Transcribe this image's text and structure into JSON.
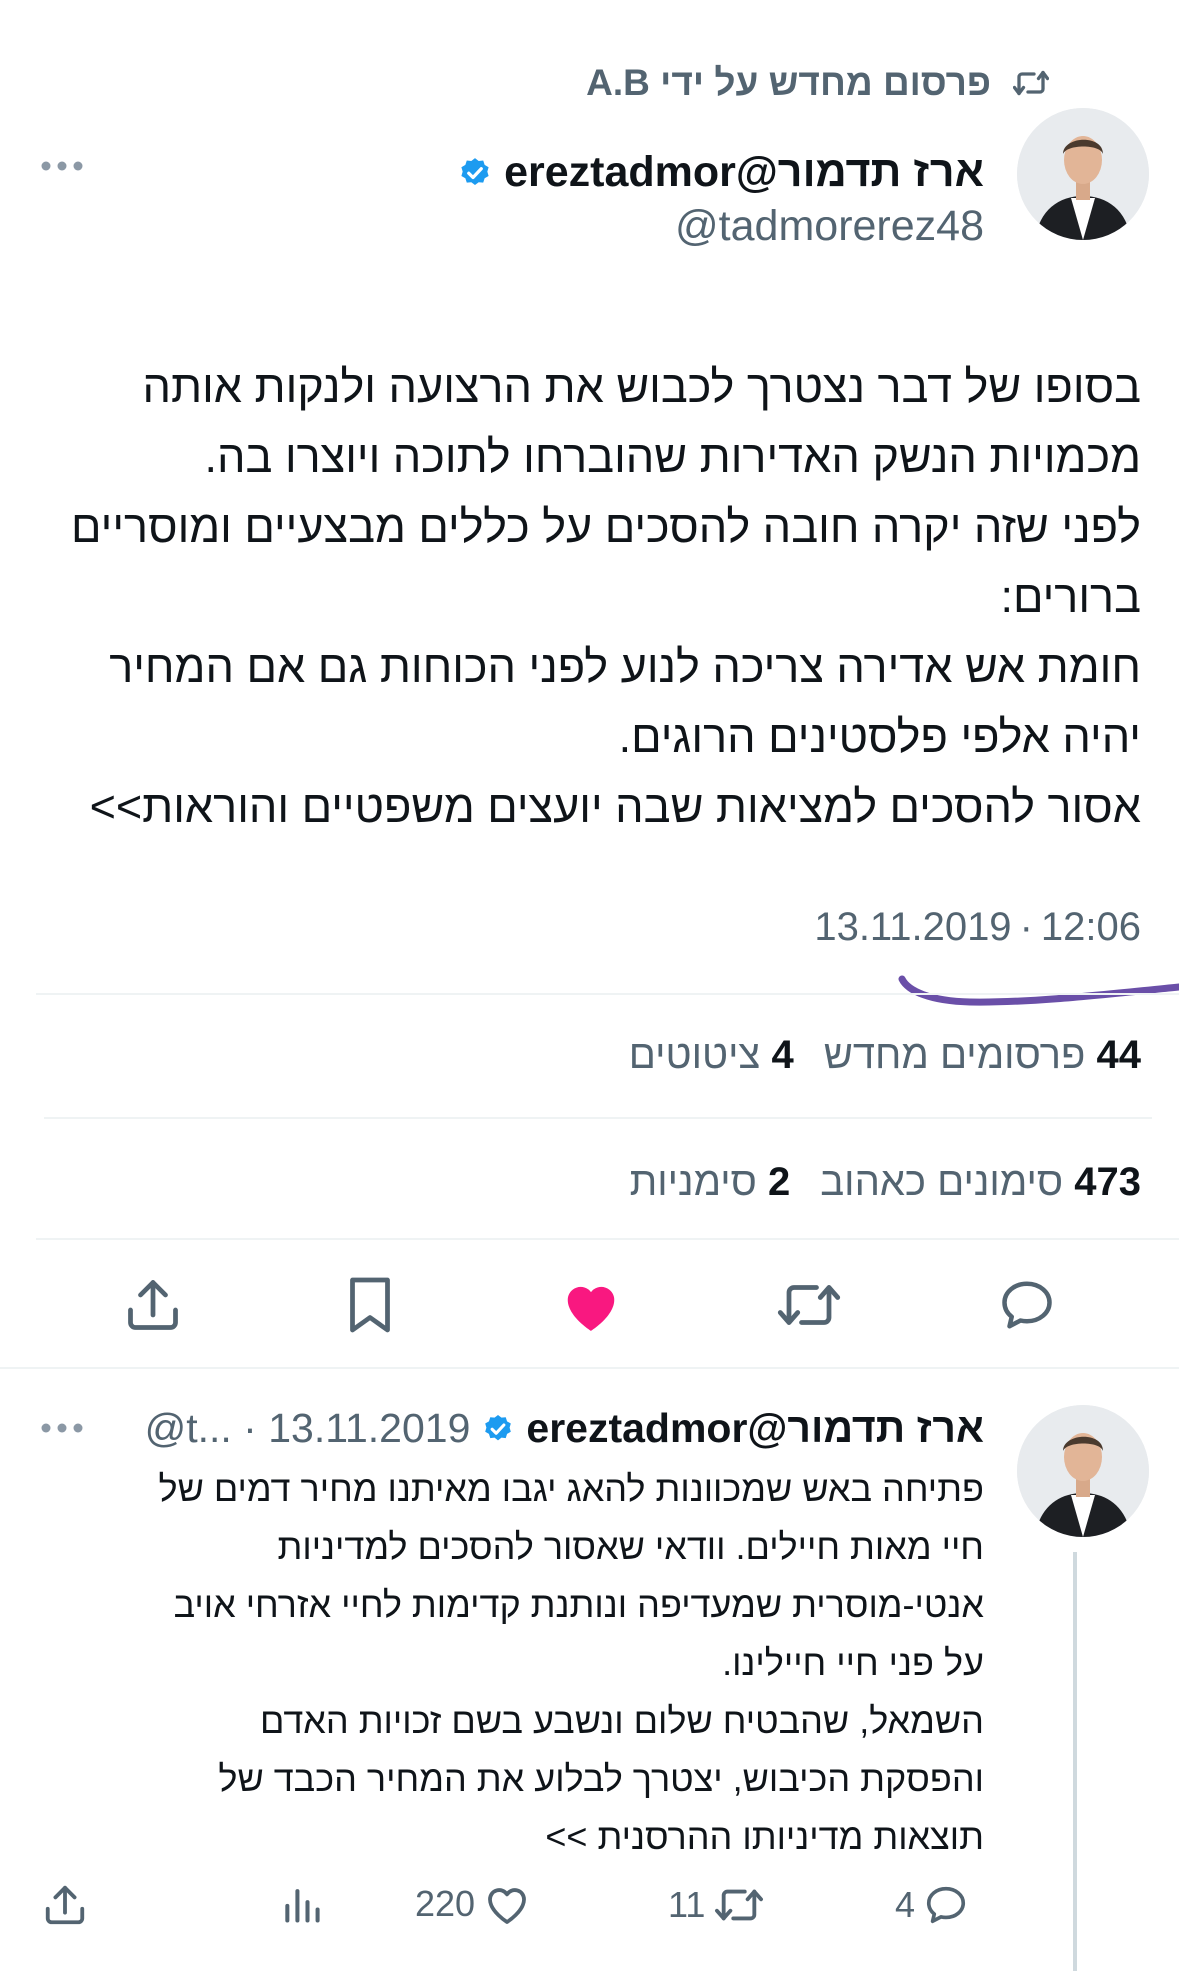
{
  "repost_header": {
    "text": "פרסום מחדש על ידי A.B"
  },
  "tweet": {
    "display_name": "ארז תדמור@ereztadmor",
    "handle": "@tadmorerez48",
    "body_lines": [
      "בסופו של דבר נצטרך לכבוש את הרצועה ולנקות אותה",
      "מכמויות הנשק האדירות שהוברחו לתוכה ויוצרו בה.",
      "לפני שזה יקרה חובה להסכים על כללים מבצעיים ומוסריים",
      "ברורים:",
      "חומת אש אדירה צריכה לנוע לפני הכוחות גם אם המחיר",
      "יהיה אלפי פלסטינים הרוגים.",
      "אסור להסכים למציאות שבה יועצים משפטיים והוראות>>"
    ],
    "time": "12:06",
    "date": "13.11.2019",
    "stats": {
      "reposts_count": "44",
      "reposts_label": "פרסומים מחדש",
      "quotes_count": "4",
      "quotes_label": "ציטוטים",
      "likes_count": "473",
      "likes_label": "סימונים כאהוב",
      "bookmarks_count": "2",
      "bookmarks_label": "סימניות"
    }
  },
  "reply": {
    "display_name": "ארז תדמור@ereztadmor",
    "meta": "@t... · 13.11.2019",
    "body_lines": [
      "פתיחה באש שמכוונות להאג יגבו מאיתנו מחיר דמים של",
      "חיי מאות חיילים. וודאי שאסור להסכים למדיניות",
      "אנטי-מוסרית שמעדיפה ונותנת קדימות לחיי אזרחי אויב",
      "על פני חיי חיילינו.",
      "השמאל, שהבטיח שלום ונשבע בשם זכויות האדם",
      "והפסקת הכיבוש, יצטרך לבלוע את המחיר הכבד של",
      "תוצאות מדיניותו ההרסנית >>"
    ],
    "replies": "4",
    "reposts": "11",
    "likes": "220"
  },
  "colors": {
    "text": "#0f1419",
    "muted": "#536471",
    "verified": "#1d9bf0",
    "liked": "#f91880",
    "annotation_stroke": "#6a4fa8",
    "divider": "#eff3f4"
  },
  "icons": [
    "repost-icon",
    "verified-badge-icon",
    "more-icon",
    "reply-icon",
    "like-icon",
    "bookmark-icon",
    "share-icon",
    "views-icon"
  ]
}
